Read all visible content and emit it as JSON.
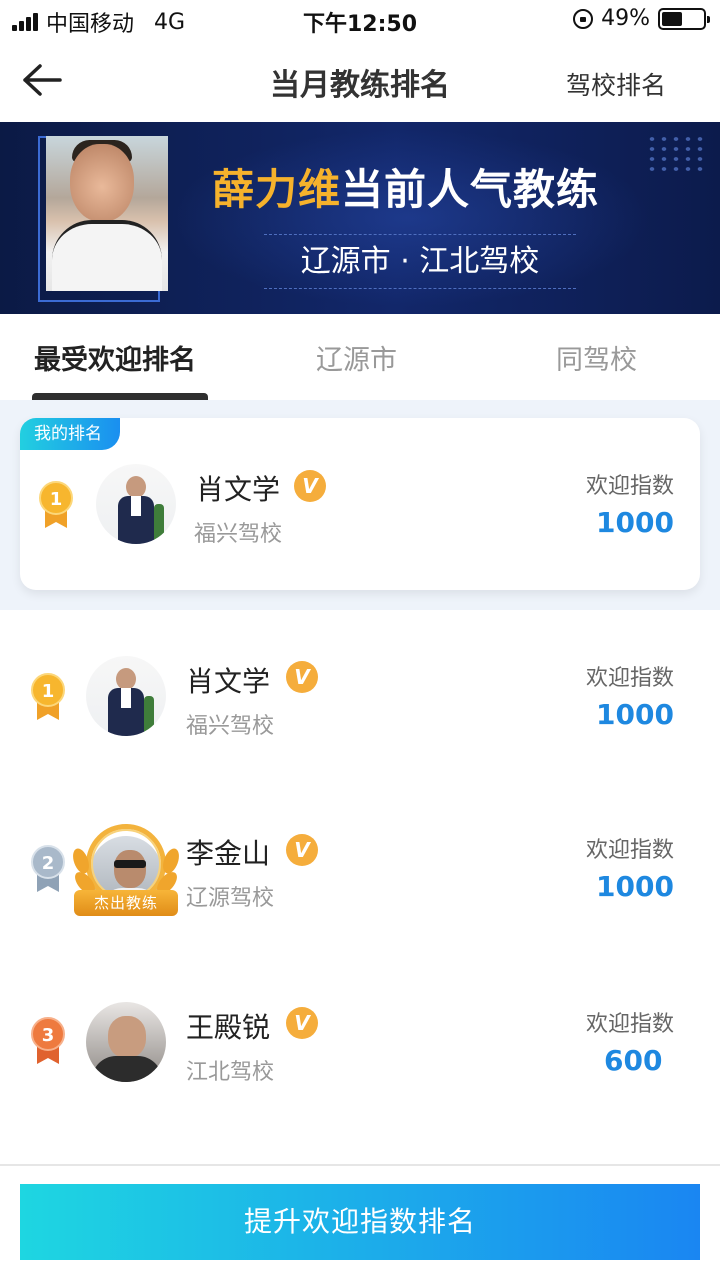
{
  "status_bar": {
    "carrier": "中国移动",
    "network": "4G",
    "time": "下午12:50",
    "battery": "49%",
    "battery_level": 0.49
  },
  "nav": {
    "title": "当月教练排名",
    "right_link": "驾校排名"
  },
  "banner": {
    "name": "薛力维",
    "title_suffix": "当前人气教练",
    "location": "辽源市 · 江北驾校"
  },
  "tabs": [
    {
      "label": "最受欢迎排名",
      "active": true
    },
    {
      "label": "辽源市",
      "active": false
    },
    {
      "label": "同驾校",
      "active": false
    }
  ],
  "my_rank": {
    "badge": "我的排名",
    "rank": "1",
    "name": "肖文学",
    "verified": "V",
    "school": "福兴驾校",
    "score_label": "欢迎指数",
    "score": "1000"
  },
  "rankings": [
    {
      "rank": "1",
      "name": "肖文学",
      "verified": "V",
      "school": "福兴驾校",
      "score_label": "欢迎指数",
      "score": "1000"
    },
    {
      "rank": "2",
      "name": "李金山",
      "verified": "V",
      "school": "辽源驾校",
      "score_label": "欢迎指数",
      "score": "1000",
      "avatar_badge": "杰出教练"
    },
    {
      "rank": "3",
      "name": "王殿锐",
      "verified": "V",
      "school": "江北驾校",
      "score_label": "欢迎指数",
      "score": "600"
    }
  ],
  "cta": {
    "label": "提升欢迎指数排名"
  },
  "colors": {
    "accent_blue": "#1e88e0",
    "gold": "#f5ad3c",
    "banner_bg": "#0b1a45",
    "cta_start": "#1ed6e1",
    "cta_end": "#1a86f2"
  }
}
